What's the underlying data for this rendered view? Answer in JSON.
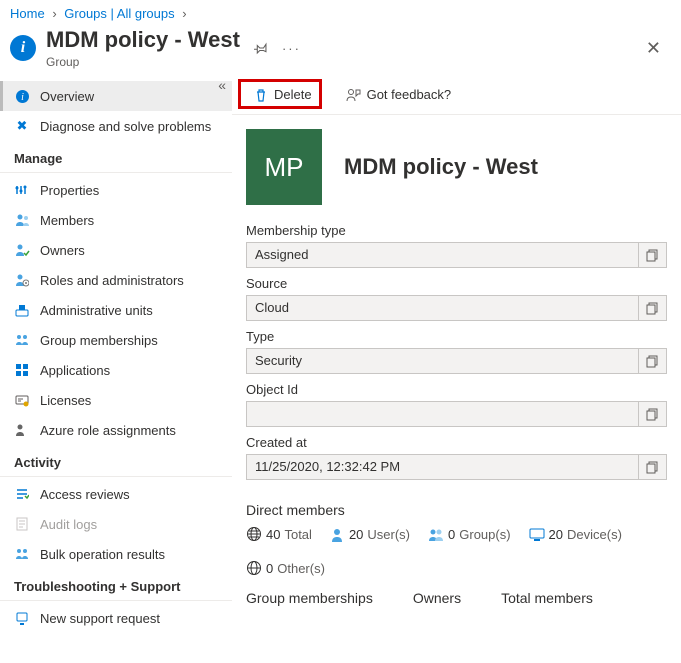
{
  "breadcrumb": {
    "home": "Home",
    "groups": "Groups | All groups"
  },
  "header": {
    "title": "MDM policy - West",
    "subtitle": "Group"
  },
  "toolbar": {
    "delete": "Delete",
    "feedback": "Got feedback?"
  },
  "sidebar": {
    "overview": "Overview",
    "diagnose": "Diagnose and solve problems",
    "manage_header": "Manage",
    "properties": "Properties",
    "members": "Members",
    "owners": "Owners",
    "roles": "Roles and administrators",
    "admin_units": "Administrative units",
    "group_memberships": "Group memberships",
    "applications": "Applications",
    "licenses": "Licenses",
    "azure_roles": "Azure role assignments",
    "activity_header": "Activity",
    "access_reviews": "Access reviews",
    "audit_logs": "Audit logs",
    "bulk_results": "Bulk operation results",
    "troubleshoot_header": "Troubleshooting + Support",
    "support": "New support request"
  },
  "group": {
    "avatar": "MP",
    "title": "MDM policy - West"
  },
  "fields": {
    "membership_label": "Membership type",
    "membership_value": "Assigned",
    "source_label": "Source",
    "source_value": "Cloud",
    "type_label": "Type",
    "type_value": "Security",
    "objectid_label": "Object Id",
    "objectid_value": "",
    "created_label": "Created at",
    "created_value": "11/25/2020, 12:32:42 PM"
  },
  "members": {
    "heading": "Direct members",
    "total_n": "40",
    "total_l": "Total",
    "users_n": "20",
    "users_l": "User(s)",
    "groups_n": "0",
    "groups_l": "Group(s)",
    "devices_n": "20",
    "devices_l": "Device(s)",
    "others_n": "0",
    "others_l": "Other(s)"
  },
  "bottom": {
    "gm": "Group memberships",
    "owners": "Owners",
    "total": "Total members"
  }
}
